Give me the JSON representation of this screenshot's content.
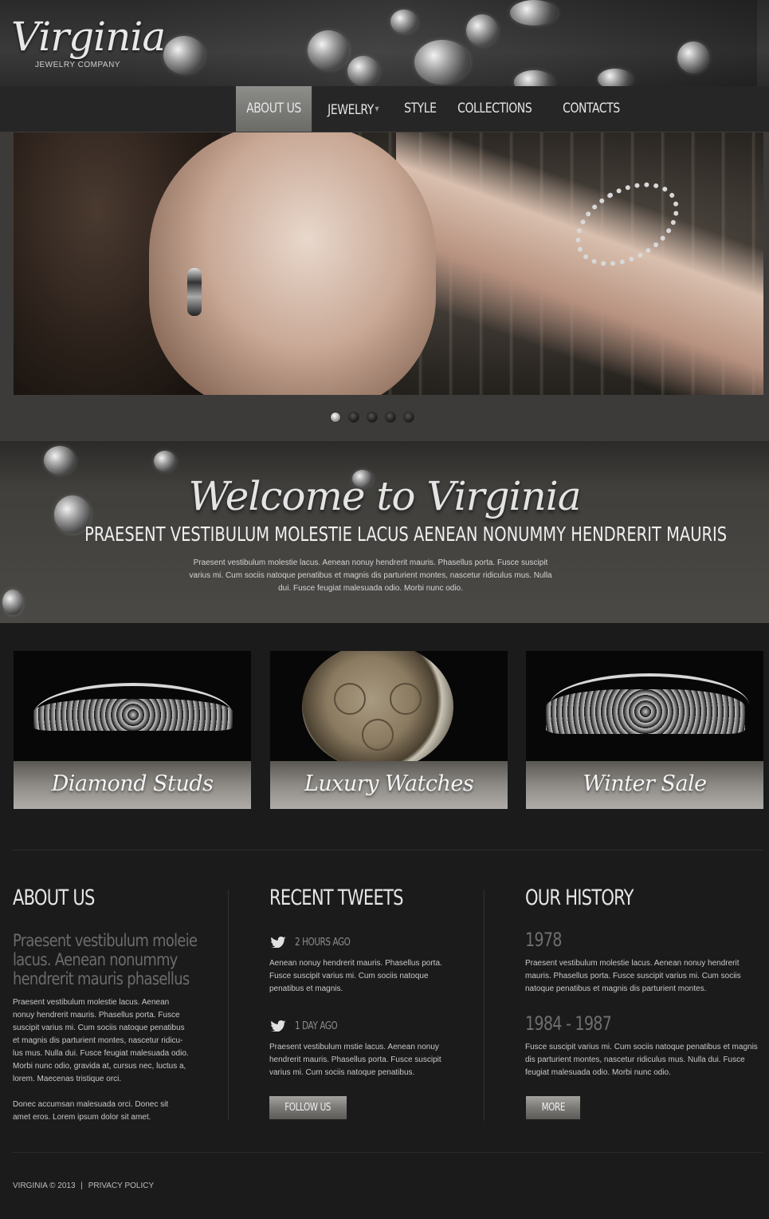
{
  "brand": {
    "name": "Virginia",
    "tagline": "JEWELRY COMPANY"
  },
  "nav": {
    "items": [
      {
        "label": "ABOUT US",
        "active": true
      },
      {
        "label": "JEWELRY",
        "active": false
      },
      {
        "label": "STYLE",
        "active": false
      },
      {
        "label": "COLLECTIONS",
        "active": false
      },
      {
        "label": "CONTACTS",
        "active": false
      }
    ]
  },
  "slider": {
    "slide_count": 5,
    "active_index": 0
  },
  "welcome": {
    "title": "Welcome to Virginia",
    "subtitle": "PRAESENT VESTIBULUM MOLESTIE LACUS AENEAN NONUMMY HENDRERIT MAURIS",
    "text": "Praesent vestibulum molestie lacus. Aenean nonuy hendrerit mauris. Phasellus porta. Fusce suscipit varius mi. Cum sociis natoque penatibus et magnis dis parturient montes, nascetur ridiculus mus. Nulla dui. Fusce feugiat malesuada odio. Morbi nunc odio."
  },
  "features": [
    {
      "caption": "Diamond Studs"
    },
    {
      "caption": "Luxury Watches"
    },
    {
      "caption": "Winter Sale"
    }
  ],
  "about": {
    "title": "ABOUT US",
    "lead_lines": [
      "Praesent  vestibulum moleie",
      "lacus. Aenean nonummy",
      "hendrerit mauris phasellus"
    ],
    "paragraph1": "Praesent vestibulum molestie lacus. Aenean nonuy hendrerit mauris. Phasellus porta. Fusce suscipit varius mi. Cum sociis natoque penatibus et magnis dis parturient montes, nascetur ridicu-lus mus. Nulla dui. Fusce feugiat malesuada odio. Morbi nunc odio, gravida at, cursus nec, luctus a, lorem. Maecenas tristique orci.",
    "paragraph2": "Donec accumsan malesuada orci. Donec sit amet eros. Lorem ipsum dolor sit amet."
  },
  "tweets": {
    "title": "RECENT TWEETS",
    "items": [
      {
        "time": "2 HOURS AGO",
        "text": "Aenean nonuy hendrerit mauris. Phasellus porta. Fusce suscipit varius mi. Cum sociis natoque penatibus et magnis."
      },
      {
        "time": "1 DAY AGO",
        "text": "Praesent vestibulum mstie lacus. Aenean nonuy hendrerit mauris. Phasellus porta. Fusce suscipit varius mi. Cum sociis natoque penatibus."
      }
    ],
    "button": "FOLLOW US"
  },
  "history": {
    "title": "OUR HISTORY",
    "items": [
      {
        "year": "1978",
        "text": "Praesent vestibulum molestie lacus. Aenean nonuy hendrerit mauris. Phasellus porta. Fusce suscipit varius mi. Cum sociis natoque penatibus et magnis dis parturient montes."
      },
      {
        "year": "1984 - 1987",
        "text": "Fusce suscipit varius mi. Cum sociis natoque penatibus et magnis dis parturient montes, nascetur ridiculus mus. Nulla dui. Fusce feugiat malesuada odio. Morbi nunc odio."
      }
    ],
    "button": "MORE"
  },
  "footer": {
    "copyright": "VIRGINIA © 2013",
    "separator": "|",
    "privacy": "PRIVACY POLICY"
  },
  "colors": {
    "background": "#1b1b1b",
    "nav_active": "#7c7c79",
    "caption_bar": "#8e8b86",
    "muted_text": "#6c6c6c"
  }
}
